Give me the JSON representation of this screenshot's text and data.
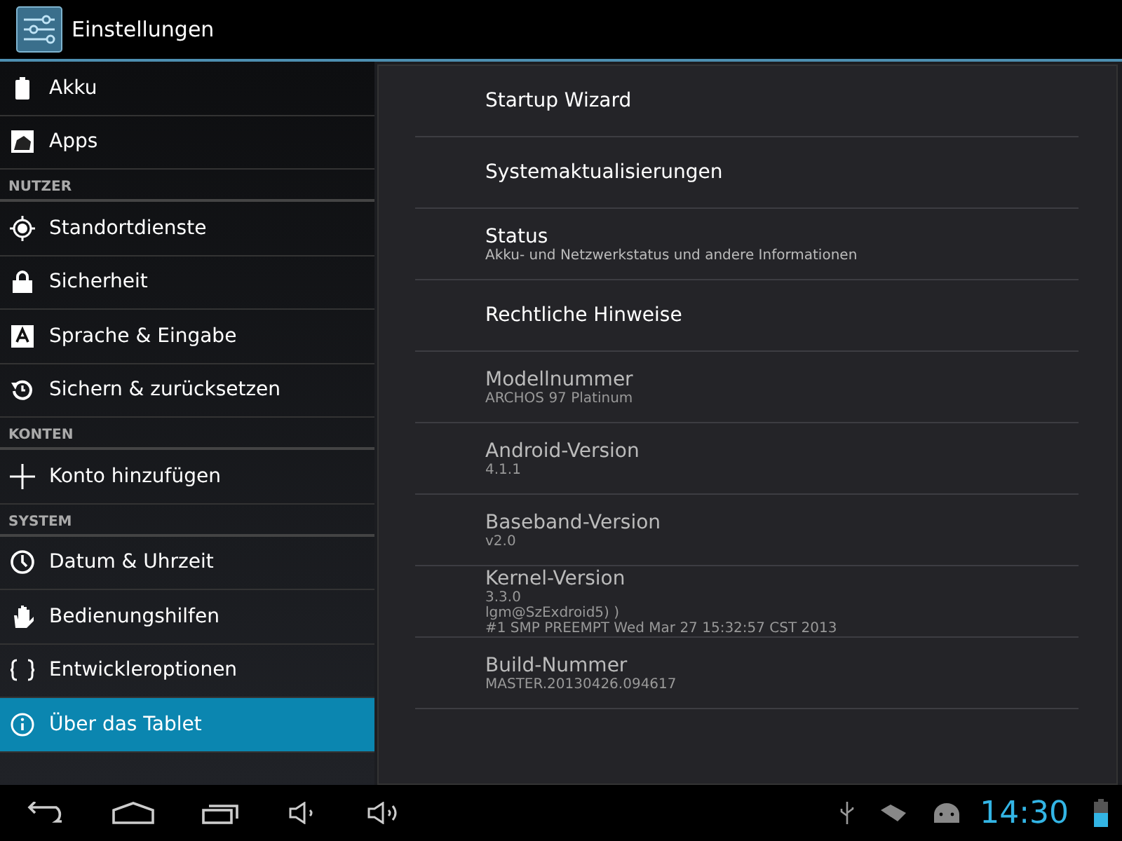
{
  "action_bar": {
    "title": "Einstellungen"
  },
  "sidebar": {
    "items": [
      {
        "kind": "item",
        "label": "Akku",
        "selected": false
      },
      {
        "kind": "item",
        "label": "Apps",
        "selected": false
      },
      {
        "kind": "header",
        "label": "NUTZER"
      },
      {
        "kind": "item",
        "label": "Standortdienste",
        "selected": false
      },
      {
        "kind": "item",
        "label": "Sicherheit",
        "selected": false
      },
      {
        "kind": "item",
        "label": "Sprache & Eingabe",
        "selected": false
      },
      {
        "kind": "item",
        "label": "Sichern & zurücksetzen",
        "selected": false
      },
      {
        "kind": "header",
        "label": "KONTEN"
      },
      {
        "kind": "item",
        "label": "Konto hinzufügen",
        "selected": false
      },
      {
        "kind": "header",
        "label": "SYSTEM"
      },
      {
        "kind": "item",
        "label": "Datum & Uhrzeit",
        "selected": false
      },
      {
        "kind": "item",
        "label": "Bedienungshilfen",
        "selected": false
      },
      {
        "kind": "item",
        "label": "Entwickleroptionen",
        "selected": false
      },
      {
        "kind": "item",
        "label": "Über das Tablet",
        "selected": true
      }
    ]
  },
  "details": [
    {
      "title": "Startup Wizard",
      "disabled": false
    },
    {
      "title": "Systemaktualisierungen",
      "disabled": false
    },
    {
      "title": "Status",
      "summary": [
        "Akku- und Netzwerkstatus und andere Informationen"
      ],
      "disabled": false
    },
    {
      "title": "Rechtliche Hinweise",
      "disabled": false
    },
    {
      "title": "Modellnummer",
      "summary": [
        "ARCHOS 97 Platinum"
      ],
      "disabled": true
    },
    {
      "title": "Android-Version",
      "summary": [
        "4.1.1"
      ],
      "disabled": true
    },
    {
      "title": "Baseband-Version",
      "summary": [
        "v2.0"
      ],
      "disabled": true
    },
    {
      "title": "Kernel-Version",
      "summary": [
        "3.3.0",
        "lgm@SzExdroid5) )",
        "#1 SMP PREEMPT Wed Mar 27 15:32:57 CST 2013"
      ],
      "disabled": true
    },
    {
      "title": "Build-Nummer",
      "summary": [
        "MASTER.20130426.094617"
      ],
      "disabled": true
    }
  ],
  "system_bar": {
    "clock": "14:30"
  }
}
